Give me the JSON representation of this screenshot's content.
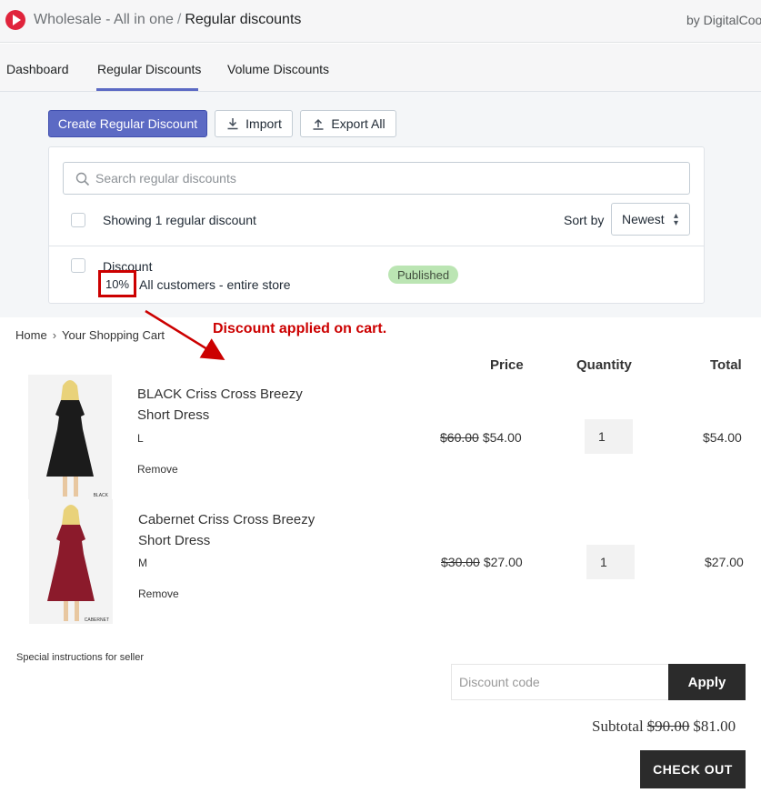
{
  "admin": {
    "breadcrumb": {
      "app": "Wholesale - All in one",
      "separator": "/",
      "current": "Regular discounts"
    },
    "developer": "by DigitalCoo",
    "tabs": [
      {
        "label": "Dashboard"
      },
      {
        "label": "Regular Discounts",
        "active": true
      },
      {
        "label": "Volume Discounts"
      }
    ],
    "actions": {
      "create": "Create Regular Discount",
      "import": "Import",
      "export": "Export All"
    },
    "search": {
      "placeholder": "Search regular discounts",
      "value": ""
    },
    "list": {
      "showing": "Showing 1 regular discount",
      "sort_label": "Sort by",
      "sort_value": "Newest"
    },
    "discount": {
      "name": "Discount",
      "percent": "10%",
      "scope": "All customers - entire store",
      "status": "Published"
    },
    "colors": {
      "primary": "#5c6ac4",
      "badge_bg": "#bbe5b3",
      "annotation": "#cc0000"
    }
  },
  "annotation": {
    "text": "Discount applied on cart."
  },
  "cart": {
    "breadcrumb": {
      "home": "Home",
      "separator": "›",
      "current": "Your Shopping Cart"
    },
    "headers": {
      "price": "Price",
      "quantity": "Quantity",
      "total": "Total"
    },
    "items": [
      {
        "name_line1": "BLACK Criss Cross Breezy",
        "name_line2": "Short Dress",
        "variant": "L",
        "remove": "Remove",
        "original_price": "$60.00",
        "price": "$54.00",
        "quantity": "1",
        "total": "$54.00",
        "image_caption": "BLACK",
        "dress_color": "#1b1b1b"
      },
      {
        "name_line1": "Cabernet Criss Cross Breezy",
        "name_line2": "Short Dress",
        "variant": "M",
        "remove": "Remove",
        "original_price": "$30.00",
        "price": "$27.00",
        "quantity": "1",
        "total": "$27.00",
        "image_caption": "CABERNET",
        "dress_color": "#8b1a2b"
      }
    ],
    "special_instructions": "Special instructions for seller",
    "discount_code": {
      "placeholder": "Discount code",
      "value": ""
    },
    "apply": "Apply",
    "subtotal": {
      "label": "Subtotal",
      "original": "$90.00",
      "value": "$81.00"
    },
    "checkout": "CHECK OUT"
  }
}
